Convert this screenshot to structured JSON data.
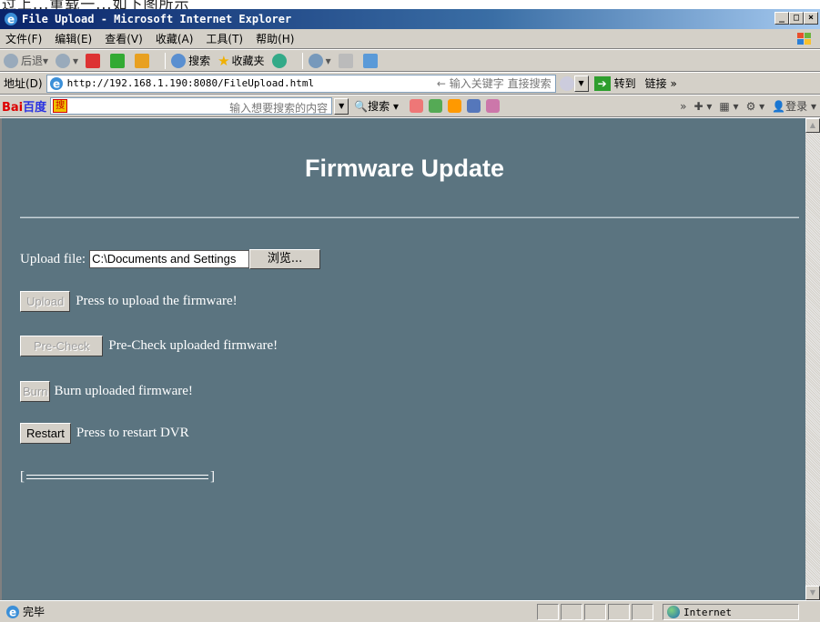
{
  "caption": "过上...重载一...如下图所示",
  "window": {
    "title": "File Upload - Microsoft Internet Explorer",
    "controls": [
      "_",
      "□",
      "×"
    ]
  },
  "menu": [
    "文件(F)",
    "编辑(E)",
    "查看(V)",
    "收藏(A)",
    "工具(T)",
    "帮助(H)"
  ],
  "toolbar": {
    "back": "后退",
    "search": "搜索",
    "favorites": "收藏夹"
  },
  "address": {
    "label": "地址(D)",
    "url": "http://192.168.1.190:8080/FileUpload.html",
    "search_hint": "← 输入关键字 直接搜索",
    "go": "转到",
    "links": "链接 »"
  },
  "baidu": {
    "logo_a": "Bai",
    "logo_b": "百度",
    "tag": "搜",
    "placeholder": "输入想要搜索的内容",
    "search": "搜索",
    "login": "登录"
  },
  "page": {
    "title": "Firmware Update",
    "upload_label": "Upload file:",
    "file_value": "C:\\Documents and Settings",
    "browse": "浏览...",
    "upload_button": "Upload",
    "upload_desc": "Press to upload the firmware!",
    "precheck_button": "Pre-Check",
    "precheck_desc": "Pre-Check uploaded firmware!",
    "burn_button": "Burn",
    "burn_desc": "Burn uploaded firmware!",
    "restart_button": "Restart",
    "restart_desc": "Press to restart DVR",
    "progress_open": "[",
    "progress_close": "]",
    "progress_value": 0
  },
  "status": {
    "text": "完毕",
    "zone": "Internet"
  },
  "colors": {
    "content_bg": "#5b7480",
    "titlebar_start": "#0a246a"
  }
}
